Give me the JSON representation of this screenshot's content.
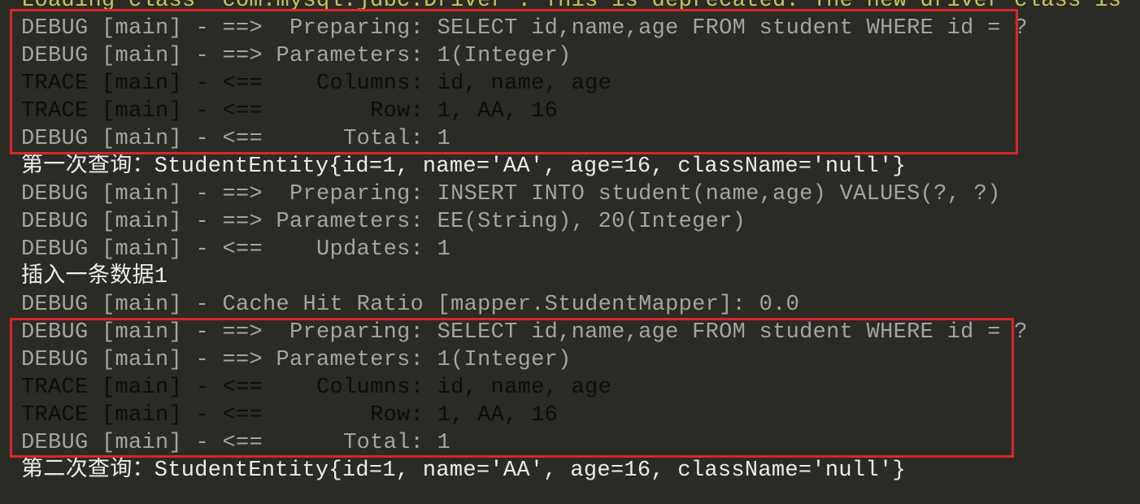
{
  "terminal": {
    "lines": [
      {
        "text": "Loading class `com.mysql.jdbc.Driver'. This is deprecated. The new driver class is `co",
        "style": "warn"
      },
      {
        "text": "DEBUG [main] - ==>  Preparing: SELECT id,name,age FROM student WHERE id = ?",
        "style": "muted"
      },
      {
        "text": "DEBUG [main] - ==> Parameters: 1(Integer)",
        "style": "muted"
      },
      {
        "text": "TRACE [main] - <==    Columns: id, name, age",
        "style": "dark"
      },
      {
        "text": "TRACE [main] - <==        Row: 1, AA, 16",
        "style": "dark"
      },
      {
        "text": "DEBUG [main] - <==      Total: 1",
        "style": "muted"
      },
      {
        "text": "第一次查询：StudentEntity{id=1, name='AA', age=16, className='null'}",
        "style": "bright"
      },
      {
        "text": "DEBUG [main] - ==>  Preparing: INSERT INTO student(name,age) VALUES(?, ?)",
        "style": "muted"
      },
      {
        "text": "DEBUG [main] - ==> Parameters: EE(String), 20(Integer)",
        "style": "muted"
      },
      {
        "text": "DEBUG [main] - <==    Updates: 1",
        "style": "muted"
      },
      {
        "text": "插入一条数据1",
        "style": "bright"
      },
      {
        "text": "DEBUG [main] - Cache Hit Ratio [mapper.StudentMapper]: 0.0",
        "style": "muted"
      },
      {
        "text": "DEBUG [main] - ==>  Preparing: SELECT id,name,age FROM student WHERE id = ?",
        "style": "muted"
      },
      {
        "text": "DEBUG [main] - ==> Parameters: 1(Integer)",
        "style": "muted"
      },
      {
        "text": "TRACE [main] - <==    Columns: id, name, age",
        "style": "dark"
      },
      {
        "text": "TRACE [main] - <==        Row: 1, AA, 16",
        "style": "dark"
      },
      {
        "text": "DEBUG [main] - <==      Total: 1",
        "style": "muted"
      },
      {
        "text": "第二次查询：StudentEntity{id=1, name='AA', age=16, className='null'}",
        "style": "bright"
      }
    ]
  },
  "colors": {
    "background": "#2b2b25",
    "debug_text": "#a4a4a0",
    "trace_text": "#0d0d0a",
    "output_text": "#ececec",
    "warning_text": "#c8c35a",
    "highlight_box": "#d8262a"
  }
}
